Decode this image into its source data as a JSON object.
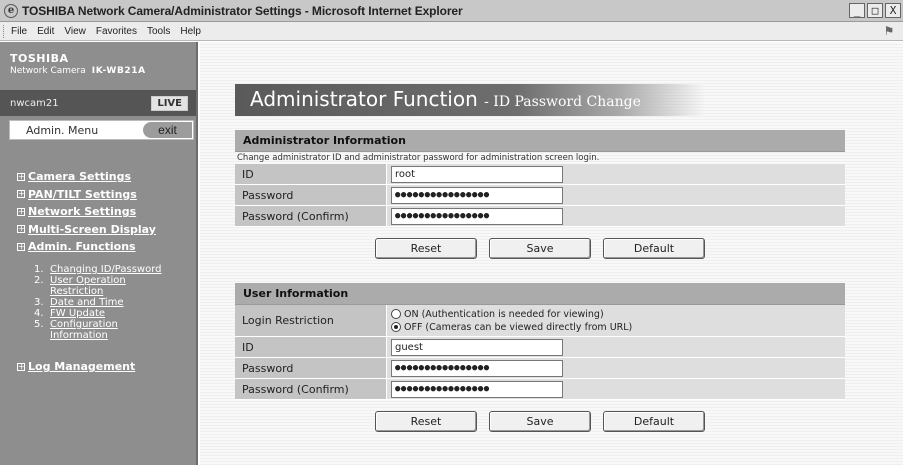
{
  "window": {
    "title": "TOSHIBA Network Camera/Administrator Settings - Microsoft Internet Explorer",
    "buttons": [
      "_",
      "□",
      "X"
    ]
  },
  "menubar": [
    "File",
    "Edit",
    "View",
    "Favorites",
    "Tools",
    "Help"
  ],
  "sidebar": {
    "company": "TOSHIBA",
    "model_label": "Network Camera",
    "model_number": "IK-WB21A",
    "camera_name": "nwcam21",
    "live_label": "LIVE",
    "admin_menu_label": "Admin. Menu",
    "exit_label": "exit",
    "nav": [
      {
        "label": "Camera Settings"
      },
      {
        "label": "PAN/TILT Settings"
      },
      {
        "label": "Network Settings"
      },
      {
        "label": "Multi-Screen Display"
      },
      {
        "label": "Admin. Functions"
      }
    ],
    "subnav": [
      {
        "num": "1.",
        "lines": [
          "Changing ID/Password"
        ]
      },
      {
        "num": "2.",
        "lines": [
          "User Operation",
          "Restriction"
        ]
      },
      {
        "num": "3.",
        "lines": [
          "Date and Time"
        ]
      },
      {
        "num": "4.",
        "lines": [
          "FW Update"
        ]
      },
      {
        "num": "5.",
        "lines": [
          "Configuration",
          "Information"
        ]
      }
    ],
    "log_label": "Log Management"
  },
  "main": {
    "title": "Administrator Function",
    "subtitle": "- ID Password Change",
    "admin_section": {
      "heading": "Administrator Information",
      "description": "Change administrator ID and administrator password for administration screen login.",
      "fields": [
        {
          "label": "ID",
          "value": "root",
          "masked": false
        },
        {
          "label": "Password",
          "value": "●●●●●●●●●●●●●●●●",
          "masked": true
        },
        {
          "label": "Password (Confirm)",
          "value": "●●●●●●●●●●●●●●●●",
          "masked": true
        }
      ]
    },
    "user_section": {
      "heading": "User Information",
      "login_restriction_label": "Login Restriction",
      "option_on": "ON (Authentication is needed for viewing)",
      "option_off": "OFF (Cameras can be viewed directly from URL)",
      "selected": "off",
      "fields": [
        {
          "label": "ID",
          "value": "guest",
          "masked": false
        },
        {
          "label": "Password",
          "value": "●●●●●●●●●●●●●●●●",
          "masked": true
        },
        {
          "label": "Password (Confirm)",
          "value": "●●●●●●●●●●●●●●●●",
          "masked": true
        }
      ]
    },
    "buttons": {
      "reset": "Reset",
      "save": "Save",
      "default": "Default"
    }
  }
}
